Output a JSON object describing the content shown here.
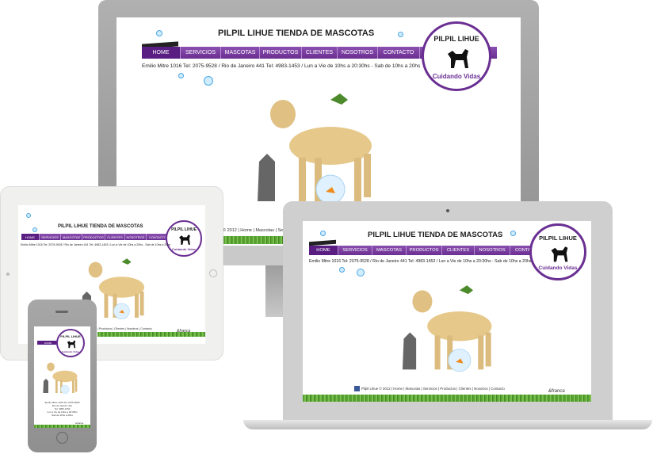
{
  "site": {
    "title": "PILPIL LIHUE TIENDA DE MASCOTAS",
    "nav": [
      "HOME",
      "SERVICIOS",
      "MASCOTAS",
      "PRODUCTOS",
      "CLIENTES",
      "NOSOTROS",
      "CONTACTO"
    ],
    "info_desktop": "Emilio Mitre 1016 Tel: 2075-9528 / Rio de Janeiro 441 Tel: 4983-1453 / Lun a Vie de 10hs a 20:30hs - Sab de 10hs a 20hs",
    "info_laptop": "Emilio Mitre 1016 Tel: 2075-9528 / Rio de Janeiro 441 Tel: 4983-1453 / Lun a Vie de 10hs a 20:30hs - Sab de 10hs a 20hs",
    "info_tablet": "Emilio Mitre 1016 Tel: 2075-9528 / Rio de Janeiro 441 Tel: 4983-1453 / Lun a Vie de 10hs a 20hs - Sab de 10hs a 20hs",
    "logo_top": "PILPIL LIHUE",
    "logo_bottom": "Cuidando Vidas",
    "footer_laptop": "Pilpil Lihue © 2012 | Home | Mascotas | Servicios | Productos | Clientes | Nosotros | Contacto",
    "footer_desktop": "© 2012 | Home | Mascotas | Serv",
    "footer_tablet": "| Productos | Clientes | Nosotros | Contacto",
    "credit": "&franca",
    "phone_nav": "HOME",
    "phone_info": [
      "Emilio Mitre 1016 Tel: 2075-9528",
      "Rio de Janeiro 441",
      "Tel: 4983-1453",
      "Lun a Vie de 10hs a 20:30hs",
      "Sab de 10hs a 20hs"
    ]
  },
  "colors": {
    "nav_purple": "#6a2f92",
    "nav_active": "#5a1e82",
    "grass": "#5aa236",
    "device_gray": "#a0a0a0",
    "tablet_white": "#f0f0ee"
  }
}
